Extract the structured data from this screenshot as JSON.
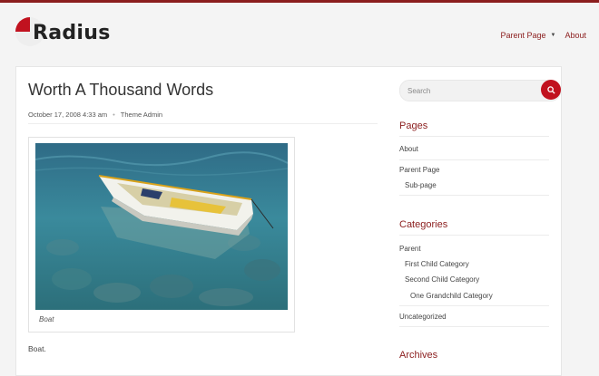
{
  "site": {
    "name": "Radius",
    "brand_color": "#8b1d1d",
    "accent_color": "#c1121f"
  },
  "nav": {
    "items": [
      {
        "label": "Parent Page",
        "has_dropdown": true
      },
      {
        "label": "About",
        "has_dropdown": false
      }
    ]
  },
  "post": {
    "title": "Worth A Thousand Words",
    "date": "October 17, 2008 4:33 am",
    "author": "Theme Admin",
    "caption": "Boat",
    "body": "Boat."
  },
  "sidebar": {
    "search": {
      "placeholder": "Search",
      "icon": "search-icon"
    },
    "pages": {
      "title": "Pages",
      "items": [
        {
          "label": "About"
        },
        {
          "label": "Parent Page"
        },
        {
          "label": "Sub-page"
        }
      ]
    },
    "categories": {
      "title": "Categories",
      "items": [
        {
          "label": "Parent"
        },
        {
          "label": "First Child Category"
        },
        {
          "label": "Second Child Category"
        },
        {
          "label": "One Grandchild Category"
        },
        {
          "label": "Uncategorized"
        }
      ]
    },
    "archives": {
      "title": "Archives"
    }
  }
}
